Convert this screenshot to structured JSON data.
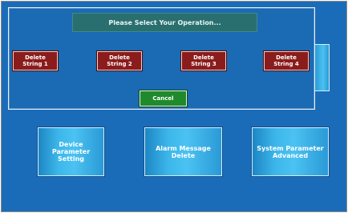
{
  "dialog": {
    "title": "Please Select Your Operation...",
    "delete_buttons": [
      {
        "line1": "Delete",
        "line2": "String 1"
      },
      {
        "line1": "Delete",
        "line2": "String 2"
      },
      {
        "line1": "Delete",
        "line2": "String 3"
      },
      {
        "line1": "Delete",
        "line2": "String 4"
      }
    ],
    "cancel_label": "Cancel"
  },
  "main_buttons": [
    {
      "line1": "Device Parameter",
      "line2": "Setting"
    },
    {
      "line1": "Alarm Message",
      "line2": "Delete"
    },
    {
      "line1": "System Parameter",
      "line2": "Advanced"
    }
  ],
  "colors": {
    "screen_background": "#1b6cb8",
    "dialog_title_background": "#2a6f6f",
    "delete_button": "#8b1c1c",
    "cancel_button": "#1f8a2c"
  }
}
